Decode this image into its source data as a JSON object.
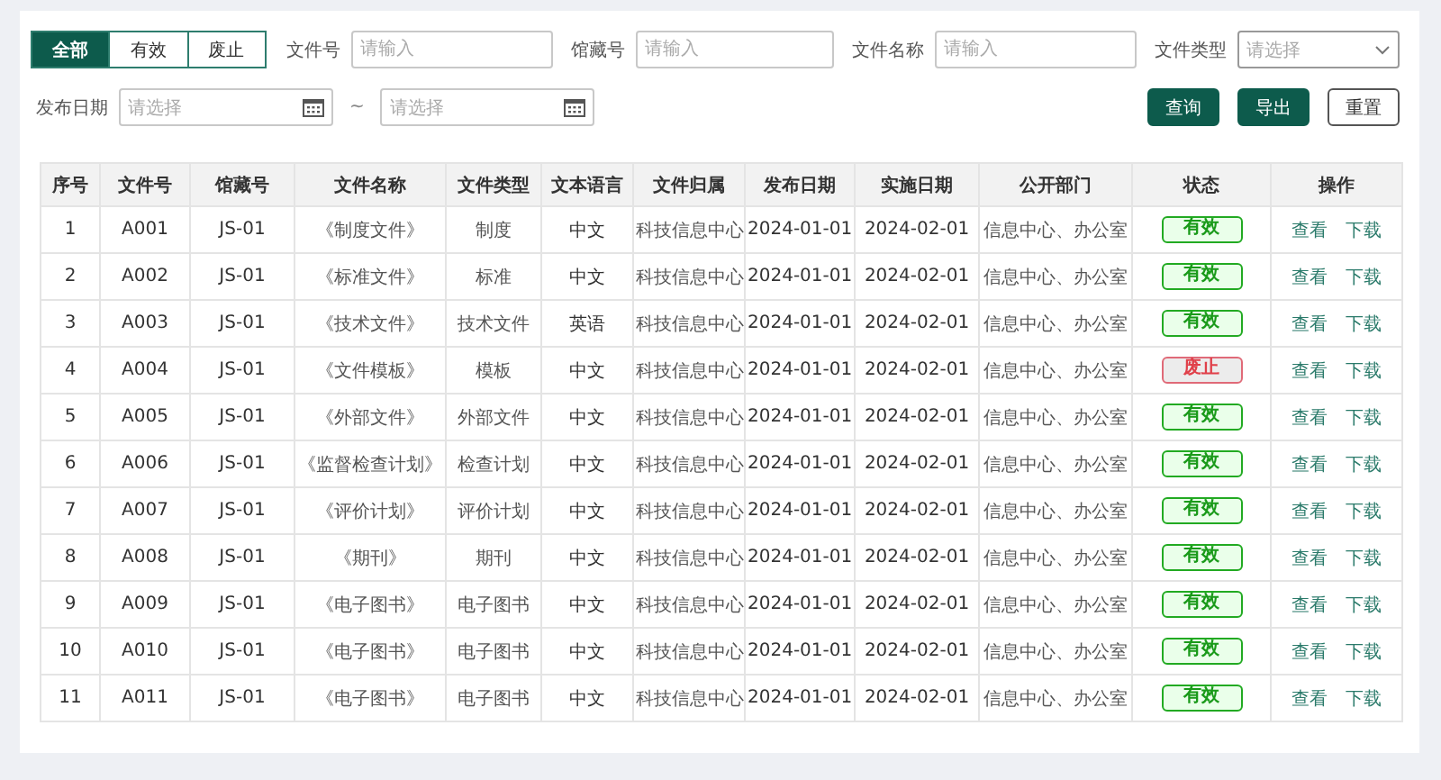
{
  "tabs": [
    {
      "label": "全部",
      "selected": true
    },
    {
      "label": "有效",
      "selected": false
    },
    {
      "label": "废止",
      "selected": false
    }
  ],
  "filters": [
    {
      "kind": "text",
      "label": "文件号",
      "placeholder": "请输入"
    },
    {
      "kind": "text",
      "label": "馆藏号",
      "placeholder": "请输入"
    },
    {
      "kind": "text",
      "label": "文件名称",
      "placeholder": "请输入"
    },
    {
      "kind": "select",
      "label": "文件类型",
      "placeholder": "请选择"
    }
  ],
  "date_filter": {
    "label": "发布日期",
    "start_placeholder": "请选择",
    "separator": "~",
    "end_placeholder": "请选择"
  },
  "buttons": [
    {
      "label": "查询",
      "kind": "primary"
    },
    {
      "label": "导出",
      "kind": "primary"
    },
    {
      "label": "重置",
      "kind": "default"
    }
  ],
  "table": {
    "columns": [
      "序号",
      "文件号",
      "馆藏号",
      "文件名称",
      "文件类型",
      "文本语言",
      "文件归属",
      "发布日期",
      "实施日期",
      "公开部门",
      "状态",
      "操作"
    ],
    "rows": [
      {
        "cells": [
          "1",
          "A001",
          "JS-01",
          "《制度文件》",
          "制度",
          "中文",
          "科技信息中心",
          "2024-01-01",
          "2024-02-01",
          "信息中心、办公室"
        ],
        "status": {
          "label": "有效",
          "kind": "valid"
        },
        "actions": [
          "查看",
          "下载"
        ]
      },
      {
        "cells": [
          "2",
          "A002",
          "JS-01",
          "《标准文件》",
          "标准",
          "中文",
          "科技信息中心",
          "2024-01-01",
          "2024-02-01",
          "信息中心、办公室"
        ],
        "status": {
          "label": "有效",
          "kind": "valid"
        },
        "actions": [
          "查看",
          "下载"
        ]
      },
      {
        "cells": [
          "3",
          "A003",
          "JS-01",
          "《技术文件》",
          "技术文件",
          "英语",
          "科技信息中心",
          "2024-01-01",
          "2024-02-01",
          "信息中心、办公室"
        ],
        "status": {
          "label": "有效",
          "kind": "valid"
        },
        "actions": [
          "查看",
          "下载"
        ]
      },
      {
        "cells": [
          "4",
          "A004",
          "JS-01",
          "《文件模板》",
          "模板",
          "中文",
          "科技信息中心",
          "2024-01-01",
          "2024-02-01",
          "信息中心、办公室"
        ],
        "status": {
          "label": "废止",
          "kind": "abolished"
        },
        "actions": [
          "查看",
          "下载"
        ]
      },
      {
        "cells": [
          "5",
          "A005",
          "JS-01",
          "《外部文件》",
          "外部文件",
          "中文",
          "科技信息中心",
          "2024-01-01",
          "2024-02-01",
          "信息中心、办公室"
        ],
        "status": {
          "label": "有效",
          "kind": "valid"
        },
        "actions": [
          "查看",
          "下载"
        ]
      },
      {
        "cells": [
          "6",
          "A006",
          "JS-01",
          "《监督检查计划》",
          "检查计划",
          "中文",
          "科技信息中心",
          "2024-01-01",
          "2024-02-01",
          "信息中心、办公室"
        ],
        "status": {
          "label": "有效",
          "kind": "valid"
        },
        "actions": [
          "查看",
          "下载"
        ]
      },
      {
        "cells": [
          "7",
          "A007",
          "JS-01",
          "《评价计划》",
          "评价计划",
          "中文",
          "科技信息中心",
          "2024-01-01",
          "2024-02-01",
          "信息中心、办公室"
        ],
        "status": {
          "label": "有效",
          "kind": "valid"
        },
        "actions": [
          "查看",
          "下载"
        ]
      },
      {
        "cells": [
          "8",
          "A008",
          "JS-01",
          "《期刊》",
          "期刊",
          "中文",
          "科技信息中心",
          "2024-01-01",
          "2024-02-01",
          "信息中心、办公室"
        ],
        "status": {
          "label": "有效",
          "kind": "valid"
        },
        "actions": [
          "查看",
          "下载"
        ]
      },
      {
        "cells": [
          "9",
          "A009",
          "JS-01",
          "《电子图书》",
          "电子图书",
          "中文",
          "科技信息中心",
          "2024-01-01",
          "2024-02-01",
          "信息中心、办公室"
        ],
        "status": {
          "label": "有效",
          "kind": "valid"
        },
        "actions": [
          "查看",
          "下载"
        ]
      },
      {
        "cells": [
          "10",
          "A010",
          "JS-01",
          "《电子图书》",
          "电子图书",
          "中文",
          "科技信息中心",
          "2024-01-01",
          "2024-02-01",
          "信息中心、办公室"
        ],
        "status": {
          "label": "有效",
          "kind": "valid"
        },
        "actions": [
          "查看",
          "下载"
        ]
      },
      {
        "cells": [
          "11",
          "A011",
          "JS-01",
          "《电子图书》",
          "电子图书",
          "中文",
          "科技信息中心",
          "2024-01-01",
          "2024-02-01",
          "信息中心、办公室"
        ],
        "status": {
          "label": "有效",
          "kind": "valid"
        },
        "actions": [
          "查看",
          "下载"
        ]
      }
    ]
  }
}
